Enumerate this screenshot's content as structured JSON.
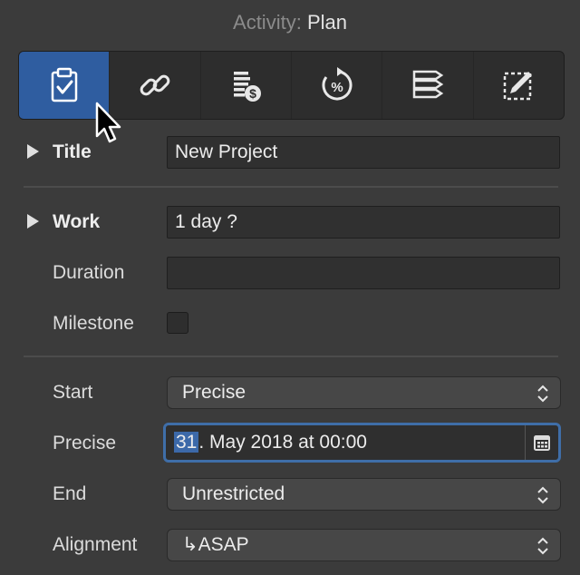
{
  "header": {
    "label": "Activity:",
    "value": "Plan"
  },
  "toolbar": {
    "tools": [
      {
        "icon": "clipboard-check-icon",
        "active": true
      },
      {
        "icon": "link-icon",
        "active": false
      },
      {
        "icon": "cost-list-icon",
        "active": false
      },
      {
        "icon": "percent-progress-icon",
        "active": false
      },
      {
        "icon": "list-tags-icon",
        "active": false
      },
      {
        "icon": "edit-note-icon",
        "active": false
      }
    ]
  },
  "title": {
    "label": "Title",
    "value": "New Project"
  },
  "work": {
    "label": "Work",
    "value": "1 day ?"
  },
  "duration": {
    "label": "Duration",
    "value": ""
  },
  "milestone": {
    "label": "Milestone",
    "checked": false
  },
  "start": {
    "label": "Start",
    "value": "Precise"
  },
  "precise": {
    "label": "Precise",
    "day": "31",
    "rest": ". May 2018 at 00:00"
  },
  "end": {
    "label": "End",
    "value": "Unrestricted"
  },
  "alignment": {
    "label": "Alignment",
    "value": "↳ASAP"
  },
  "colors": {
    "accent": "#2f5da0",
    "focus_ring": "#3f6ea8",
    "background": "#3b3b3b"
  }
}
